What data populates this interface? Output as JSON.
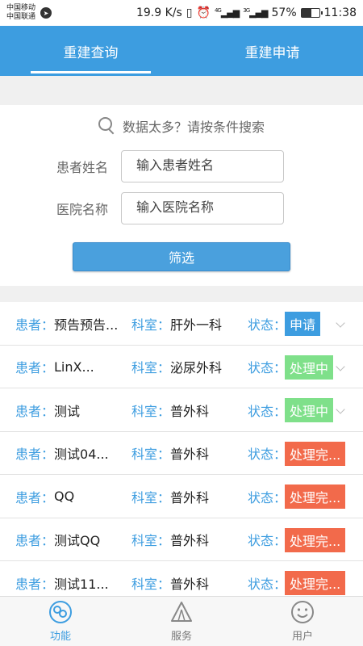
{
  "status_bar": {
    "carrier1": "中国移动",
    "carrier2": "中国联通",
    "speed": "19.9 K/s",
    "battery_pct": "57%",
    "battery_level": 0.57,
    "time": "11:38",
    "signal_4g": "4G",
    "signal_3g": "3G"
  },
  "tabs": [
    {
      "label": "重建查询",
      "active": true
    },
    {
      "label": "重建申请",
      "active": false
    }
  ],
  "search": {
    "hint": "数据太多？请按条件搜索",
    "patient_label": "患者姓名",
    "patient_placeholder": "输入患者姓名",
    "hospital_label": "医院名称",
    "hospital_placeholder": "输入医院名称",
    "filter_button": "筛选"
  },
  "list_labels": {
    "patient": "患者：",
    "dept": "科室：",
    "status": "状态："
  },
  "records": [
    {
      "patient": "预告预告...",
      "dept": "肝外一科",
      "status": "申请",
      "status_color": "#3d9de0",
      "expandable": true
    },
    {
      "patient": "LinX...",
      "dept": "泌尿外科",
      "status": "处理中",
      "status_color": "#7fe08a",
      "expandable": true
    },
    {
      "patient": "测试",
      "dept": "普外科",
      "status": "处理中",
      "status_color": "#7fe08a",
      "expandable": true
    },
    {
      "patient": "测试04...",
      "dept": "普外科",
      "status": "处理完...",
      "status_color": "#f26a4b",
      "expandable": false
    },
    {
      "patient": "QQ",
      "dept": "普外科",
      "status": "处理完...",
      "status_color": "#f26a4b",
      "expandable": false
    },
    {
      "patient": "测试QQ",
      "dept": "普外科",
      "status": "处理完...",
      "status_color": "#f26a4b",
      "expandable": false
    },
    {
      "patient": "测试11...",
      "dept": "普外科",
      "status": "处理完...",
      "status_color": "#f26a4b",
      "expandable": false
    }
  ],
  "bottom_nav": [
    {
      "label": "功能",
      "icon": "function-icon",
      "active": true
    },
    {
      "label": "服务",
      "icon": "service-icon",
      "active": false
    },
    {
      "label": "用户",
      "icon": "user-icon",
      "active": false
    }
  ],
  "colors": {
    "primary": "#3d9de0",
    "processing": "#7fe08a",
    "done": "#f26a4b"
  }
}
